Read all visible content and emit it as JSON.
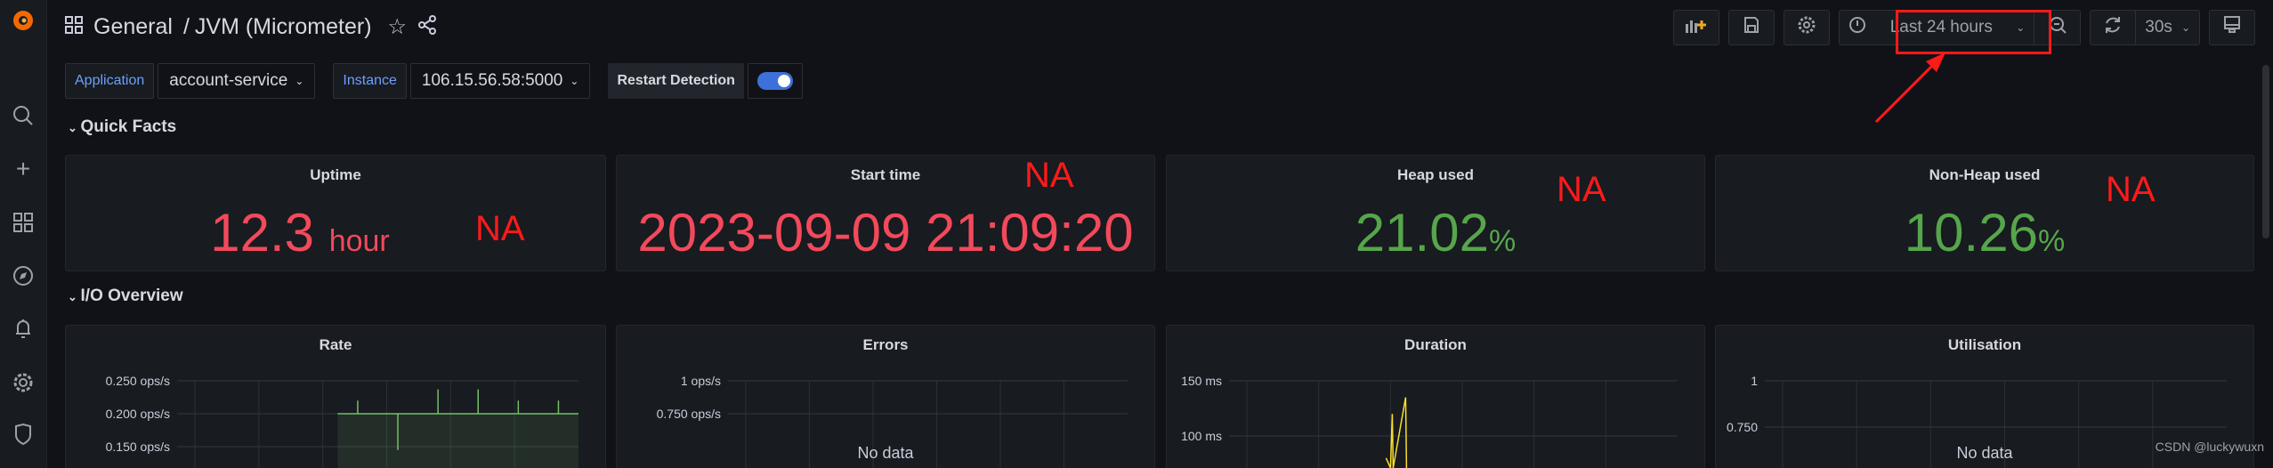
{
  "header": {
    "breadcrumb_folder": "General",
    "breadcrumb_sep": "/",
    "dashboard_title": "JVM (Micrometer)",
    "time_range": "Last 24 hours",
    "refresh_interval": "30s"
  },
  "variables": {
    "application_label": "Application",
    "application_value": "account-service",
    "instance_label": "Instance",
    "instance_value": "106.15.56.58:5000",
    "restart_label": "Restart Detection",
    "restart_enabled": true
  },
  "rows": {
    "quick_facts": "Quick Facts",
    "io_overview": "I/O Overview"
  },
  "stats": [
    {
      "title": "Uptime",
      "value": "12.3",
      "unit": "hour",
      "color": "#f2495c",
      "annotation": "NA"
    },
    {
      "title": "Start time",
      "value": "2023-09-09 21:09:20",
      "unit": "",
      "color": "#f2495c",
      "annotation": "NA"
    },
    {
      "title": "Heap used",
      "value": "21.02",
      "unit": "%",
      "color": "#56a64b",
      "annotation": "NA"
    },
    {
      "title": "Non-Heap used",
      "value": "10.26",
      "unit": "%",
      "color": "#56a64b",
      "annotation": "NA"
    }
  ],
  "panels": {
    "rate": "Rate",
    "errors": "Errors",
    "duration": "Duration",
    "utilisation": "Utilisation",
    "no_data": "No data"
  },
  "chart_data": [
    {
      "type": "line",
      "title": "Rate",
      "yticks": [
        "0.250 ops/s",
        "0.200 ops/s",
        "0.150 ops/s"
      ],
      "series": [
        {
          "color": "#73bf69",
          "values": [
            0.2,
            0.22,
            0.2,
            0.145,
            0.2,
            0.237,
            0.2,
            0.237,
            0.2,
            0.22,
            0.2,
            0.22,
            0.2
          ]
        }
      ]
    },
    {
      "type": "line",
      "title": "Errors",
      "yticks": [
        "1 ops/s",
        "0.750 ops/s"
      ],
      "series": []
    },
    {
      "type": "line",
      "title": "Duration",
      "yticks": [
        "150 ms",
        "100 ms"
      ],
      "series": [
        {
          "color": "#fade2a",
          "values": [
            80,
            62,
            120,
            60,
            135,
            60
          ]
        }
      ]
    },
    {
      "type": "line",
      "title": "Utilisation",
      "yticks": [
        "1",
        "0.750"
      ],
      "series": []
    }
  ],
  "watermark": "CSDN @luckywuxn"
}
